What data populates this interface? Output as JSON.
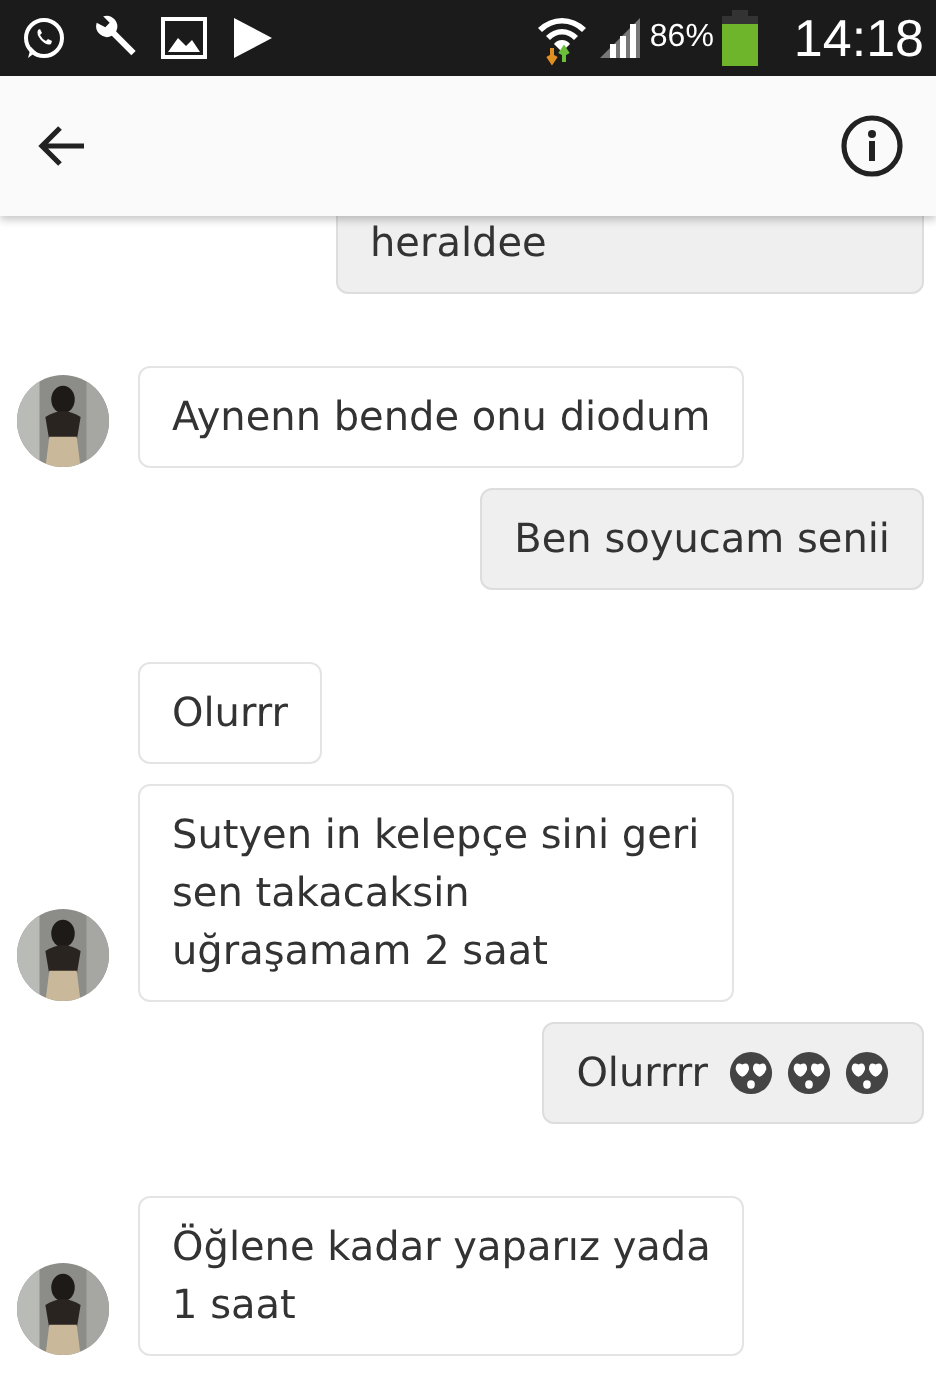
{
  "status_bar": {
    "battery_text": "86%",
    "time": "14:18"
  },
  "messages": [
    {
      "kind": "outgoing",
      "lines": [
        "heraldee"
      ],
      "cut_top": true
    },
    {
      "kind": "incoming",
      "avatar": true,
      "lines": [
        "Aynenn bende onu diodum"
      ]
    },
    {
      "kind": "outgoing",
      "lines": [
        "Ben soyucam senii"
      ]
    },
    {
      "kind": "incoming",
      "avatar": false,
      "lines": [
        "Olurrr"
      ]
    },
    {
      "kind": "incoming",
      "avatar": true,
      "lines": [
        "Sutyen in kelepçe sini geri",
        "sen takacaksin",
        "uğraşamam 2 saat"
      ]
    },
    {
      "kind": "outgoing",
      "lines": [
        "Olurrrr"
      ],
      "emojis": [
        {
          "kind": "heart-eyes"
        },
        {
          "kind": "heart-eyes"
        },
        {
          "kind": "heart-eyes"
        }
      ]
    },
    {
      "kind": "incoming",
      "avatar": true,
      "lines": [
        "Öğlene kadar yaparız yada",
        "1 saat"
      ]
    }
  ]
}
